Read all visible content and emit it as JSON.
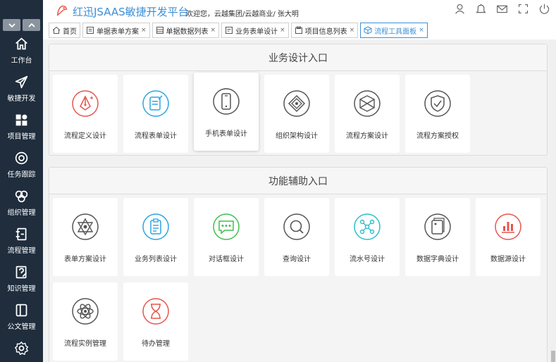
{
  "header": {
    "title": "红迅JSAAS敏捷开发平台",
    "welcome": "欢迎您，云越集团/云越商业/ 张大明"
  },
  "sidebar": {
    "items": [
      {
        "label": "工作台",
        "icon": "home-icon"
      },
      {
        "label": "敏捷开发",
        "icon": "paper-plane-icon"
      },
      {
        "label": "项目管理",
        "icon": "grid-icon"
      },
      {
        "label": "任务跟踪",
        "icon": "target-icon"
      },
      {
        "label": "组织管理",
        "icon": "org-icon"
      },
      {
        "label": "流程管理",
        "icon": "flow-icon"
      },
      {
        "label": "知识管理",
        "icon": "knowledge-icon"
      },
      {
        "label": "公文管理",
        "icon": "document-icon"
      },
      {
        "label": "",
        "icon": "gear-icon"
      }
    ]
  },
  "tabs": [
    {
      "label": "首页",
      "closable": false
    },
    {
      "label": "单据表单方案",
      "closable": true
    },
    {
      "label": "单据数据列表",
      "closable": true
    },
    {
      "label": "业务表单设计",
      "closable": true
    },
    {
      "label": "项目信息列表",
      "closable": true
    },
    {
      "label": "流程工具面板",
      "closable": true,
      "active": true
    }
  ],
  "tab_close_glyph": "×",
  "sections": {
    "business": {
      "title": "业务设计入口",
      "cards": [
        {
          "label": "流程定义设计",
          "color": "#e8554e",
          "icon": "pen-nib-icon"
        },
        {
          "label": "流程表单设计",
          "color": "#2aa6e0",
          "icon": "form-edit-icon"
        },
        {
          "label": "手机表单设计",
          "color": "#555555",
          "icon": "mobile-icon"
        },
        {
          "label": "组织架构设计",
          "color": "#555555",
          "icon": "org-structure-icon"
        },
        {
          "label": "流程方案设计",
          "color": "#555555",
          "icon": "cube-icon"
        },
        {
          "label": "流程方案授权",
          "color": "#555555",
          "icon": "shield-check-icon"
        }
      ]
    },
    "function": {
      "title": "功能辅助入口",
      "cards": [
        {
          "label": "表单方案设计",
          "color": "#555555",
          "icon": "star-structure-icon"
        },
        {
          "label": "业务列表设计",
          "color": "#2aa6e0",
          "icon": "clipboard-icon"
        },
        {
          "label": "对话框设计",
          "color": "#3fbf4f",
          "icon": "chat-icon"
        },
        {
          "label": "查询设计",
          "color": "#555555",
          "icon": "search-icon"
        },
        {
          "label": "流水号设计",
          "color": "#2bbfcf",
          "icon": "network-icon"
        },
        {
          "label": "数据字典设计",
          "color": "#555555",
          "icon": "dictionary-icon"
        },
        {
          "label": "数据源设计",
          "color": "#e8554e",
          "icon": "bar-chart-icon"
        },
        {
          "label": "流程实例管理",
          "color": "#555555",
          "icon": "atom-icon"
        },
        {
          "label": "待办管理",
          "color": "#e8554e",
          "icon": "hourglass-icon"
        }
      ]
    }
  }
}
